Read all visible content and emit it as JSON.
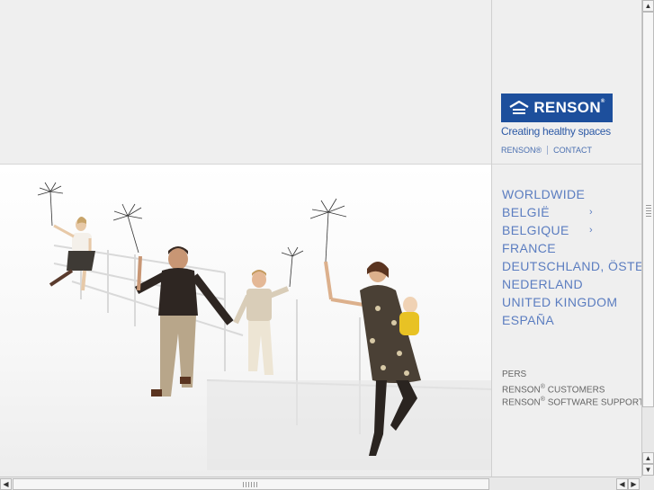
{
  "brand": {
    "name": "RENSON",
    "registered": "®",
    "tagline": "Creating healthy spaces"
  },
  "top_links": [
    {
      "label": "RENSON®"
    },
    {
      "label": "CONTACT"
    }
  ],
  "countries": [
    {
      "label": "WORLDWIDE",
      "has_submenu": false
    },
    {
      "label": "BELGIË",
      "has_submenu": true
    },
    {
      "label": "BELGIQUE",
      "has_submenu": true
    },
    {
      "label": "FRANCE",
      "has_submenu": false
    },
    {
      "label": "DEUTSCHLAND, ÖSTERREICH",
      "has_submenu": false
    },
    {
      "label": "NEDERLAND",
      "has_submenu": false
    },
    {
      "label": "UNITED KINGDOM",
      "has_submenu": false
    },
    {
      "label": "ESPAÑA",
      "has_submenu": false
    }
  ],
  "submenu_arrow": "›",
  "bottom_links": [
    {
      "label": "PERS",
      "sup": ""
    },
    {
      "prefix": "RENSON",
      "sup": "®",
      "label": " CUSTOMERS"
    },
    {
      "prefix": "RENSON",
      "sup": "®",
      "label": " SOFTWARE SUPPORT"
    }
  ],
  "scrollbar": {
    "up": "▲",
    "down": "▼",
    "left": "◀",
    "right": "▶"
  },
  "colors": {
    "brand_blue": "#1d4f9c",
    "link_blue": "#5b7dc0",
    "background": "#efefef"
  },
  "icons": {
    "logo": "house-roof-icon",
    "submenu": "chevron-right-icon"
  }
}
